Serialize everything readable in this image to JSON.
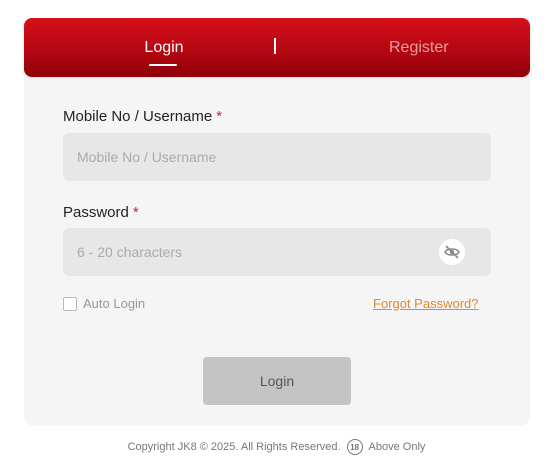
{
  "tabs": {
    "login_label": "Login",
    "separator": "|",
    "register_label": "Register"
  },
  "form": {
    "username_label": "Mobile No / Username",
    "username_required": "*",
    "username_placeholder": "Mobile No / Username",
    "password_label": "Password",
    "password_required": "*",
    "password_placeholder": "6 - 20 characters",
    "auto_login_label": "Auto Login",
    "forgot_label": "Forgot Password?",
    "submit_label": "Login"
  },
  "footer": {
    "copyright": "Copyright JK8 © 2025. All Rights Reserved.",
    "age_badge": "18",
    "age_note": "Above Only"
  },
  "colors": {
    "brand_red": "#c10a14",
    "forgot_orange": "#e08a2c",
    "required_red": "#d41f2a"
  },
  "icons": {
    "password_toggle": "eye-slash-icon",
    "age_restriction": "age-18-icon"
  }
}
